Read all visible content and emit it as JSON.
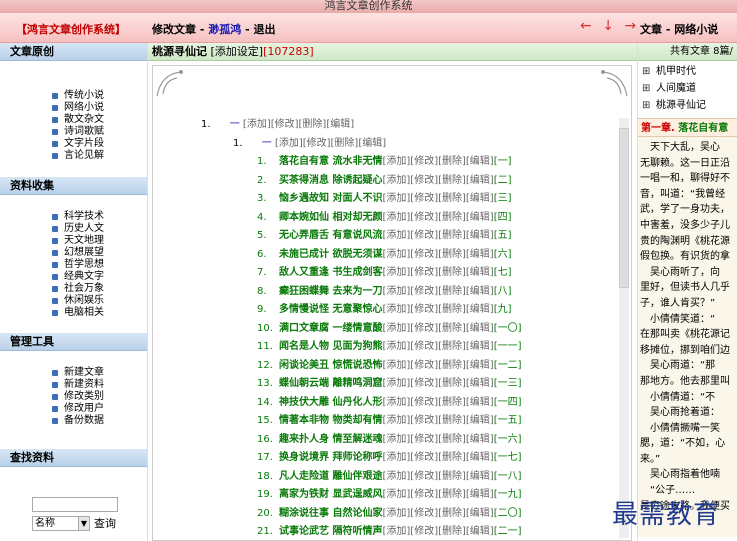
{
  "window": {
    "title": "鸿言文章创作系统"
  },
  "header": {
    "system_name": "【鸿言文章创作系统】",
    "menu_edit": "修改文章",
    "menu_sep": " - ",
    "menu_user": "渺孤鸿",
    "menu_logout": "退出",
    "arrows": [
      "←",
      "↓",
      "→"
    ],
    "right_title": "文章 - 网络小说"
  },
  "sidebar": {
    "sections": [
      {
        "title": "文章原创",
        "items": [
          "传统小说",
          "网络小说",
          "散文杂文",
          "诗词歌赋",
          "文字片段",
          "言论见解"
        ]
      },
      {
        "title": "资料收集",
        "items": [
          "科学技术",
          "历史人文",
          "天文地理",
          "幻想展望",
          "哲学思想",
          "经典文字",
          "社会万象",
          "休闲娱乐",
          "电脑相关"
        ]
      },
      {
        "title": "管理工具",
        "items": [
          "新建文章",
          "新建资料",
          "修改类别",
          "修改用户",
          "备份数据"
        ]
      },
      {
        "title": "查找资料",
        "items": []
      }
    ],
    "search": {
      "input_value": "",
      "select_value": "名称",
      "button": "查询"
    }
  },
  "main": {
    "book_title": "桃源寻仙记",
    "add_setting": "[添加设定]",
    "char_count": "[107283]",
    "level1": {
      "num": "1.",
      "dash": "一",
      "ops": "[添加][修改][删除][编辑]"
    },
    "level2": {
      "num": "1.",
      "dash": "一",
      "ops": "[添加][修改][删除][编辑]"
    },
    "op_labels": "[添加][修改][删除][编辑]",
    "chapters": [
      {
        "n": "1.",
        "title": "落花自有意 流水非无情",
        "idx": "[一]"
      },
      {
        "n": "2.",
        "title": "买茶得消息 除诱起疑心",
        "idx": "[二]"
      },
      {
        "n": "3.",
        "title": "恼乡遇故知 对面人不识",
        "idx": "[三]"
      },
      {
        "n": "4.",
        "title": "卿本婉如仙 相对却无颜",
        "idx": "[四]"
      },
      {
        "n": "5.",
        "title": "无心弄唇舌 有意说风流",
        "idx": "[五]"
      },
      {
        "n": "6.",
        "title": "未施已成计 欲脱无须谋",
        "idx": "[六]"
      },
      {
        "n": "7.",
        "title": "敌人又重逢 书生成剑客",
        "idx": "[七]"
      },
      {
        "n": "8.",
        "title": "癫狂困蝶舞 去来为一刀",
        "idx": "[八]"
      },
      {
        "n": "9.",
        "title": "多情慢说怪 无意聚惊心",
        "idx": "[九]"
      },
      {
        "n": "10.",
        "title": "满口文章腐 一缕情意酸",
        "idx": "[一〇]"
      },
      {
        "n": "11.",
        "title": "闻名是人物 见面为狗熊",
        "idx": "[一一]"
      },
      {
        "n": "12.",
        "title": "闲谈论美丑 惊慌说恐怖",
        "idx": "[一二]"
      },
      {
        "n": "13.",
        "title": "蝶仙朝云端 離精鸣洞窟",
        "idx": "[一三]"
      },
      {
        "n": "14.",
        "title": "神技伏大雕 仙丹化人形",
        "idx": "[一四]"
      },
      {
        "n": "15.",
        "title": "情著本非物 物类却有情",
        "idx": "[一五]"
      },
      {
        "n": "16.",
        "title": "趣来扑人身 情至解迷魂",
        "idx": "[一六]"
      },
      {
        "n": "17.",
        "title": "换身说境界 拜师论称呼",
        "idx": "[一七]"
      },
      {
        "n": "18.",
        "title": "凡人走险道 雕仙伴艰途",
        "idx": "[一八]"
      },
      {
        "n": "19.",
        "title": "离家为铁财 显武逞威风",
        "idx": "[一九]"
      },
      {
        "n": "20.",
        "title": "糊涂说往事 自然论仙家",
        "idx": "[二〇]"
      },
      {
        "n": "21.",
        "title": "试事论武艺 隔符听情声",
        "idx": "[二一]"
      }
    ]
  },
  "right": {
    "total": "共有文章 8篇/",
    "books": [
      "机甲时代",
      "人间魔道",
      "桃源寻仙记"
    ],
    "chapter_label": "第一章.",
    "chapter_title": "落花自有意",
    "text_lines": [
      "　天下大乱，吴心",
      "无聊赖。这一日正沿",
      "一唱一和，聊得好不",
      "音，叫道：“我曾经",
      "武，学了一身功夫，",
      "中害羞，没多少子儿",
      "贵的陶渊明《桃花源",
      "假包换。有识货的拿",
      "　吴心雨听了，向",
      "里好，但读书人几乎",
      "子，谁人肯买？”",
      "　小倩倩笑道：“",
      "在那叫卖《桃花源记",
      "移摊位，挪到咱们边",
      "　吴心雨道：“那",
      "那地方。他去那里叫",
      "　小倩倩道：“不",
      "　吴心雨抢着道：",
      "　小倩倩撅嘴一笑",
      "腮，道：“不如，心",
      "来。”",
      "　吴心雨指着他喃",
      "　“公子……",
      "是穷途末路。我便买"
    ]
  },
  "watermark": {
    "text": "最需教育"
  }
}
